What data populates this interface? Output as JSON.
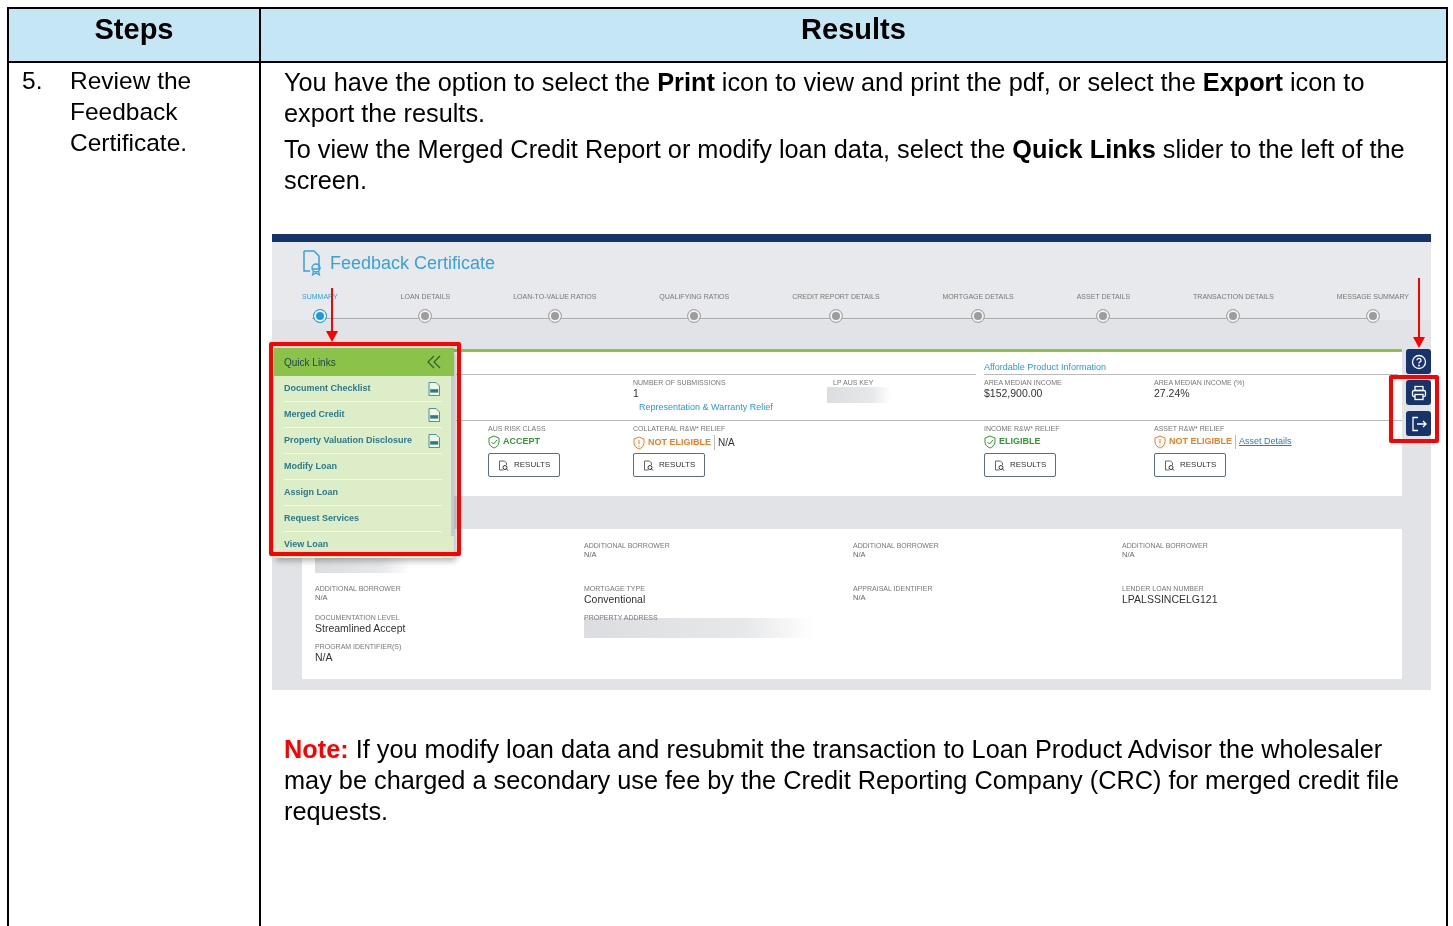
{
  "table": {
    "columns": [
      "Steps",
      "Results"
    ],
    "step": {
      "number": "5.",
      "text": "Review the Feedback Certificate."
    },
    "paragraphs": [
      "You have the option to select the **Print** icon to view and print the pdf, or select the **Export** icon to export the results.",
      "To view the Merged Credit Report or modify loan data, select the **Quick Links** slider to the left of the screen."
    ],
    "note": "**Note:** If you modify loan data and resubmit the transaction to Loan Product Advisor the wholesaler may be charged a secondary use fee by the Credit Reporting Company (CRC) for merged credit file requests."
  },
  "screenshot": {
    "title": "Feedback Certificate",
    "steps": [
      {
        "label": "SUMMARY",
        "selected": true
      },
      {
        "label": "LOAN DETAILS",
        "selected": false
      },
      {
        "label": "LOAN-TO-VALUE RATIOS",
        "selected": false
      },
      {
        "label": "QUALIFYING RATIOS",
        "selected": false
      },
      {
        "label": "CREDIT REPORT DETAILS",
        "selected": false
      },
      {
        "label": "MORTGAGE DETAILS",
        "selected": false
      },
      {
        "label": "ASSET DETAILS",
        "selected": false
      },
      {
        "label": "TRANSACTION DETAILS",
        "selected": false
      },
      {
        "label": "MESSAGE SUMMARY",
        "selected": false
      }
    ],
    "quick_links": {
      "framed": true,
      "arrowed": true,
      "title": "Quick Links",
      "items": [
        {
          "label": "Document Checklist",
          "pdf": true
        },
        {
          "label": "Merged Credit",
          "pdf": true
        },
        {
          "label": "Property Valuation Disclosure",
          "pdf": true
        },
        {
          "label": "Modify Loan",
          "pdf": false
        },
        {
          "label": "Assign Loan",
          "pdf": false
        },
        {
          "label": "Request Services",
          "pdf": false
        },
        {
          "label": "View Loan",
          "pdf": false
        }
      ]
    },
    "summary": {
      "submissions": {
        "label": "NUMBER OF SUBMISSIONS",
        "value": "1"
      },
      "lp_key": {
        "label": "LP AUS KEY"
      },
      "affordable": {
        "title": "Affordable Product Information",
        "fields": [
          {
            "label": "AREA MEDIAN INCOME",
            "value": "$152,900.00"
          },
          {
            "label": "AREA MEDIAN INCOME (%)",
            "value": "27.24%"
          }
        ]
      },
      "rw_title": "Representation & Warranty Relief",
      "results": [
        {
          "label": "AUS RISK CLASS",
          "status": "ACCEPT",
          "kind": "ok",
          "button": "RESULTS"
        },
        {
          "label": "COLLATERAL R&W* RELIEF",
          "status": "NOT ELIGIBLE",
          "kind": "warn",
          "extra": "N/A",
          "button": "RESULTS"
        },
        {
          "label": "INCOME R&W* RELIEF",
          "status": "ELIGIBLE",
          "kind": "ok",
          "button": "RESULTS"
        },
        {
          "label": "ASSET R&W* RELIEF",
          "status": "NOT ELIGIBLE",
          "kind": "warn",
          "link": "Asset Details",
          "button": "RESULTS"
        }
      ]
    },
    "details": [
      [
        {
          "kind": "redacted"
        },
        {
          "kind": "small",
          "label": "ADDITIONAL BORROWER",
          "value": "N/A"
        },
        {
          "kind": "small",
          "label": "ADDITIONAL BORROWER",
          "value": "N/A"
        },
        {
          "kind": "small",
          "label": "ADDITIONAL BORROWER",
          "value": "N/A"
        }
      ],
      [
        {
          "kind": "small",
          "label": "ADDITIONAL BORROWER",
          "value": "N/A"
        },
        {
          "kind": "large",
          "label": "MORTGAGE TYPE",
          "value": "Conventional"
        },
        {
          "kind": "small",
          "label": "APPRAISAL IDENTIFIER",
          "value": "N/A"
        },
        {
          "kind": "large",
          "label": "LENDER LOAN NUMBER",
          "value": "LPALSSINCELG121"
        }
      ],
      [
        {
          "kind": "large",
          "label": "DOCUMENTATION LEVEL",
          "value": "Streamlined Accept"
        },
        {
          "kind": "redacted",
          "label": "PROPERTY ADDRESS"
        }
      ],
      [
        {
          "kind": "large",
          "label": "PROGRAM IDENTIFIER(S)",
          "value": "N/A"
        }
      ]
    ],
    "side_tools": {
      "framed": true,
      "arrowed": true,
      "buttons": [
        {
          "kind": "help"
        },
        {
          "kind": "print"
        },
        {
          "kind": "export"
        }
      ]
    }
  }
}
